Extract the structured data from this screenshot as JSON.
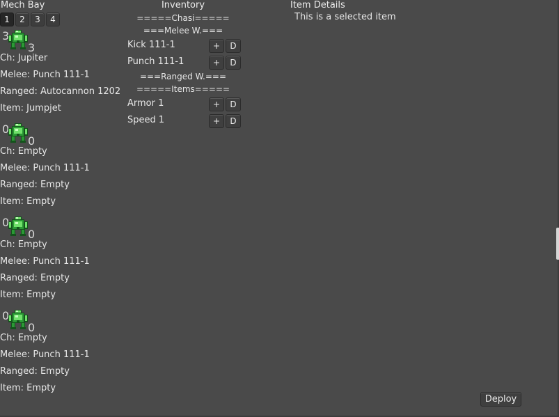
{
  "mech_bay": {
    "title": "Mech Bay",
    "tabs": [
      "1",
      "2",
      "3",
      "4"
    ],
    "active_tab": 0,
    "mechs": [
      {
        "count_left": "3",
        "count_right": "3",
        "chassis": "Ch: Jupiter",
        "melee": "Melee: Punch 111-1",
        "ranged": "Ranged: Autocannon 1202",
        "item": "Item: Jumpjet"
      },
      {
        "count_left": "0",
        "count_right": "0",
        "chassis": "Ch: Empty",
        "melee": "Melee: Punch 111-1",
        "ranged": "Ranged: Empty",
        "item": "Item: Empty"
      },
      {
        "count_left": "0",
        "count_right": "0",
        "chassis": "Ch: Empty",
        "melee": "Melee: Punch 111-1",
        "ranged": "Ranged: Empty",
        "item": "Item: Empty"
      },
      {
        "count_left": "0",
        "count_right": "0",
        "chassis": "Ch: Empty",
        "melee": "Melee: Punch 111-1",
        "ranged": "Ranged: Empty",
        "item": "Item: Empty"
      }
    ]
  },
  "inventory": {
    "title": "Inventory",
    "chassis_header": "=====Chasi=====",
    "melee_header": "===Melee W.===",
    "melee_items": [
      {
        "name": "Kick 111-1",
        "add": "+",
        "delete": "D"
      },
      {
        "name": "Punch 111-1",
        "add": "+",
        "delete": "D"
      }
    ],
    "ranged_header": "===Ranged W.===",
    "items_header": "=====Items=====",
    "items": [
      {
        "name": "Armor 1",
        "add": "+",
        "delete": "D"
      },
      {
        "name": "Speed 1",
        "add": "+",
        "delete": "D"
      }
    ]
  },
  "item_details": {
    "title": "Item Details",
    "text": "This is a selected item"
  },
  "actions": {
    "deploy_label": "Deploy"
  },
  "icons": {
    "mech": "mech-robot-icon",
    "mech_colors": {
      "dark": "#14521c",
      "mid": "#2b9a35",
      "light": "#6fe06a",
      "highlight": "#c8ffc0"
    }
  }
}
